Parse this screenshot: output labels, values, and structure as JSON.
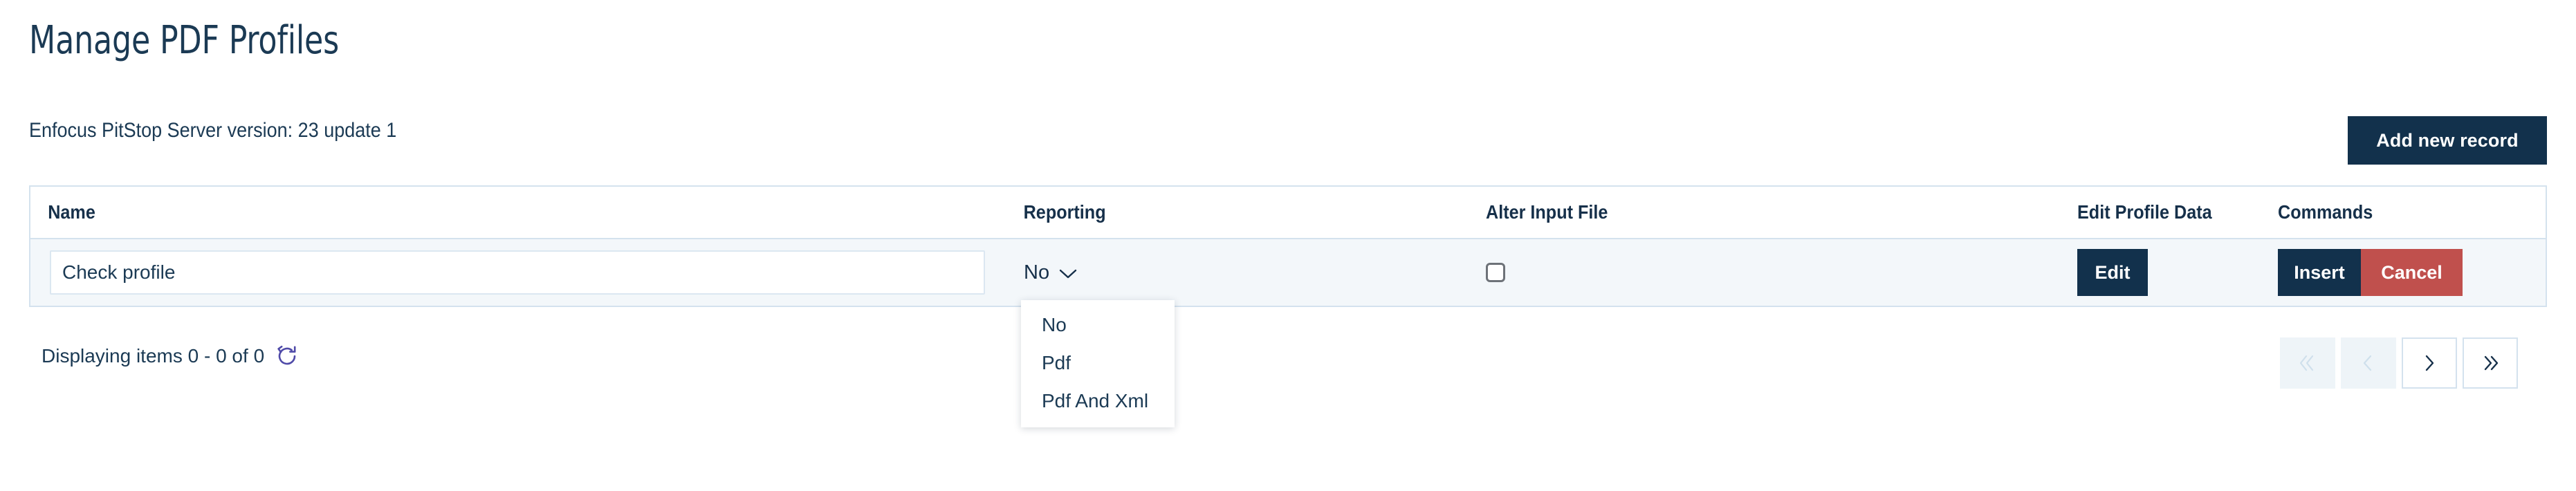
{
  "header": {
    "title": "Manage PDF Profiles",
    "version_text": "Enfocus PitStop Server version: 23 update 1",
    "add_record_label": "Add new record"
  },
  "table": {
    "columns": [
      {
        "key": "name",
        "label": "Name"
      },
      {
        "key": "reporting",
        "label": "Reporting"
      },
      {
        "key": "alter_input_file",
        "label": "Alter Input File"
      },
      {
        "key": "edit_profile_data",
        "label": "Edit Profile Data"
      },
      {
        "key": "commands",
        "label": "Commands"
      }
    ],
    "row": {
      "name_value": "Check profile",
      "name_placeholder": "",
      "reporting_selected": "No",
      "alter_input_file_checked": false,
      "edit_label": "Edit",
      "insert_label": "Insert",
      "cancel_label": "Cancel"
    }
  },
  "reporting_dropdown": {
    "open": true,
    "options": [
      {
        "label": "No"
      },
      {
        "label": "Pdf"
      },
      {
        "label": "Pdf And Xml"
      }
    ]
  },
  "footer": {
    "displaying_text": "Displaying items 0 - 0 of 0",
    "refresh_icon": "refresh-icon",
    "pagination": [
      {
        "name": "first-page",
        "glyph": "double-chevron-left-icon",
        "enabled": false
      },
      {
        "name": "previous-page",
        "glyph": "chevron-left-icon",
        "enabled": false
      },
      {
        "name": "next-page",
        "glyph": "chevron-right-icon",
        "enabled": true
      },
      {
        "name": "last-page",
        "glyph": "double-chevron-right-icon",
        "enabled": true
      }
    ]
  },
  "colors": {
    "navy": "#12314c",
    "red": "#c0504d",
    "row_bg": "#f3f7fa",
    "border": "#d4e2ee",
    "refresh_purple": "#4f4aa8",
    "text": "#16304a"
  }
}
